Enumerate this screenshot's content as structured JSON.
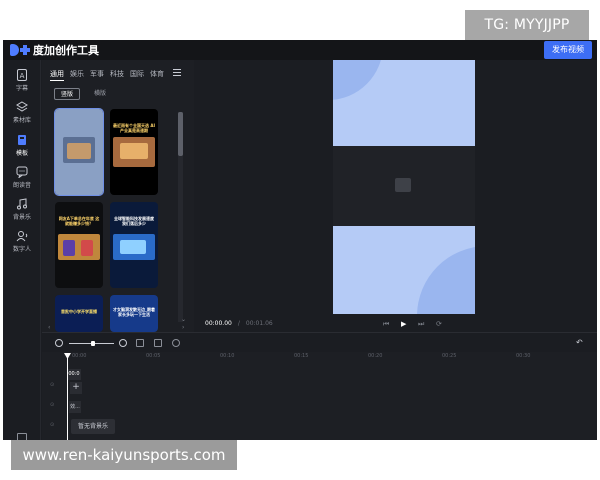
{
  "watermarks": {
    "top": "TG: MYYJJPP",
    "bottom": "www.ren-kaiyunsports.com"
  },
  "app": {
    "title": "度加创作工具",
    "publish_label": "发布视频"
  },
  "nav": [
    {
      "label": "字幕",
      "icon": "text-icon"
    },
    {
      "label": "素材库",
      "icon": "layers-icon"
    },
    {
      "label": "模板",
      "icon": "template-icon",
      "active": true
    },
    {
      "label": "朗读音",
      "icon": "speech-icon"
    },
    {
      "label": "背景乐",
      "icon": "music-icon"
    },
    {
      "label": "数字人",
      "icon": "avatar-icon"
    }
  ],
  "panel": {
    "tabs": [
      "通用",
      "娱乐",
      "军事",
      "科技",
      "国际",
      "体育"
    ],
    "active_tab": "通用",
    "segments": [
      "竖版",
      "横版"
    ],
    "active_segment": "竖版",
    "cards": [
      {
        "title": "",
        "selected": true
      },
      {
        "title": "最近雨有个全国天选 AI产业真是高速期"
      },
      {
        "title": "网友A下单总在年底 这就能赚多少钱？"
      },
      {
        "title": "全球智能科技发展速度 我们落后多少"
      },
      {
        "title": "首批中小学开学直播"
      },
      {
        "title": "才女脑洞发散无边_跟着 家长多玩一下生活"
      }
    ]
  },
  "player": {
    "current_time": "00:00.00",
    "duration": "00:01.06"
  },
  "timeline": {
    "ruler": [
      "00:00",
      "00:05",
      "00:10",
      "00:15",
      "00:20",
      "00:25",
      "00:30"
    ],
    "clip_time": "00:0",
    "add_label": "+",
    "small_clip": "效...",
    "music_placeholder": "暂无背景乐"
  },
  "colors": {
    "accent": "#3d6ef5",
    "frame": "#b5cbf6",
    "app_bg": "#1b1d22"
  }
}
